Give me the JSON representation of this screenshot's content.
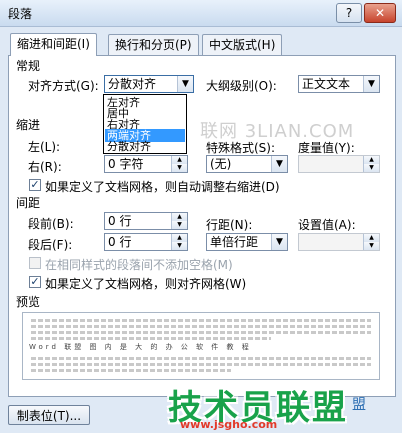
{
  "window": {
    "title": "段落",
    "help_label": "?",
    "close_label": "✕"
  },
  "tabs": [
    {
      "label": "缩进和间距(I)"
    },
    {
      "label": "换行和分页(P)"
    },
    {
      "label": "中文版式(H)"
    }
  ],
  "general": {
    "title": "常规",
    "alignment_label": "对齐方式(G):",
    "alignment_value": "分散对齐",
    "alignment_options": [
      "左对齐",
      "居中",
      "右对齐",
      "两端对齐",
      "分散对齐"
    ],
    "alignment_highlighted": "两端对齐",
    "outline_label": "大纲级别(O):",
    "outline_value": "正文文本"
  },
  "indent": {
    "title": "缩进",
    "left_label": "左(L):",
    "right_label": "右(R):",
    "right_value": "0 字符",
    "special_label": "特殊格式(S):",
    "special_value": "(无)",
    "measure_label": "度量值(Y):",
    "auto_adjust_label": "如果定义了文档网格，则自动调整右缩进(D)",
    "auto_adjust_checked": true
  },
  "spacing": {
    "title": "间距",
    "before_label": "段前(B):",
    "before_value": "0 行",
    "after_label": "段后(F):",
    "after_value": "0 行",
    "line_label": "行距(N):",
    "line_value": "单倍行距",
    "at_label": "设置值(A):",
    "no_space_label": "在相同样式的段落间不添加空格(M)",
    "no_space_checked": false,
    "snap_grid_label": "如果定义了文档网格，则对齐网格(W)",
    "snap_grid_checked": true
  },
  "preview": {
    "title": "预览",
    "sample": "Word 联盟 图 内 是 大 的 办 公 软 件 教 程"
  },
  "buttons": {
    "tabs_label": "制表位(T)..."
  },
  "watermark": {
    "text": "联网 3LIAN.COM",
    "logo": "技术员联盟",
    "url": "www.jsgho.com",
    "corner": "盟"
  },
  "check_mark": "✓"
}
